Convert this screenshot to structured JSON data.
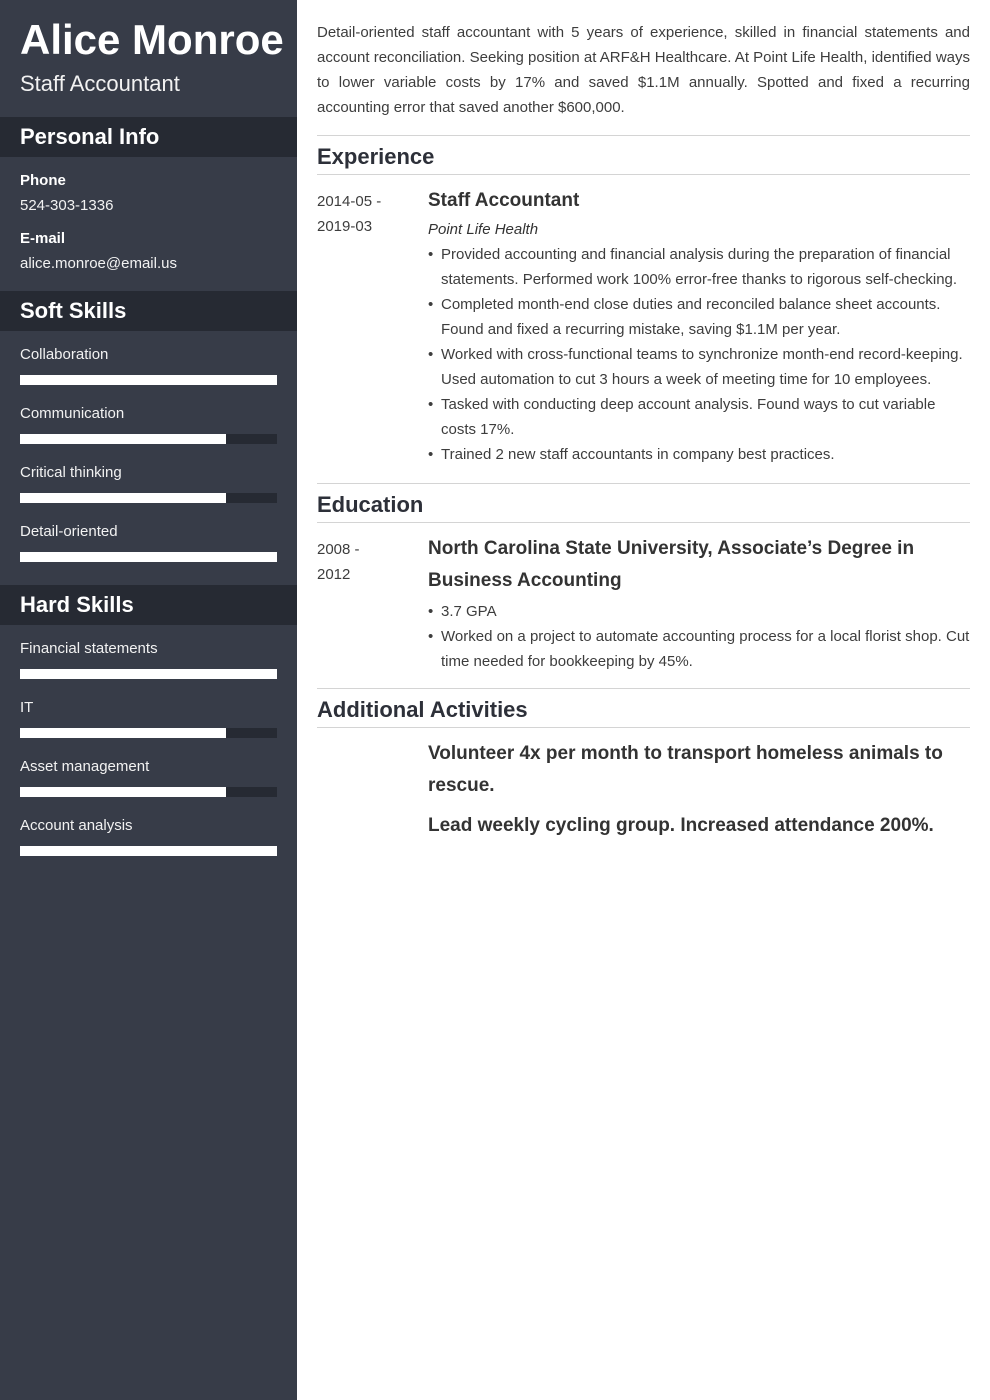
{
  "profile": {
    "name": "Alice Monroe",
    "title": "Staff Accountant"
  },
  "sidebar": {
    "personal_info": {
      "heading": "Personal Info",
      "phone_label": "Phone",
      "phone": "524-303-1336",
      "email_label": "E-mail",
      "email": "alice.monroe@email.us"
    },
    "soft_skills": {
      "heading": "Soft Skills",
      "items": [
        {
          "name": "Collaboration",
          "level": 1.0
        },
        {
          "name": "Communication",
          "level": 0.8
        },
        {
          "name": "Critical thinking",
          "level": 0.8
        },
        {
          "name": "Detail-oriented",
          "level": 1.0
        }
      ]
    },
    "hard_skills": {
      "heading": "Hard Skills",
      "items": [
        {
          "name": "Financial statements",
          "level": 1.0
        },
        {
          "name": "IT",
          "level": 0.8
        },
        {
          "name": "Asset management",
          "level": 0.8
        },
        {
          "name": "Account analysis",
          "level": 1.0
        }
      ]
    }
  },
  "summary": "Detail-oriented staff accountant with 5 years of experience, skilled in financial statements and account reconciliation. Seeking position at ARF&H Healthcare. At Point Life Health, identified ways to lower variable costs by 17% and saved $1.1M annually. Spotted and fixed a recurring accounting error that saved another $600,000.",
  "experience": {
    "heading": "Experience",
    "entries": [
      {
        "date_start": "2014-05 -",
        "date_end": "2019-03",
        "title": "Staff Accountant",
        "company": "Point Life Health",
        "bullets": [
          "Provided accounting and financial analysis during the preparation of financial statements. Performed work 100% error-free thanks to rigorous self-checking.",
          "Completed month-end close duties and reconciled balance sheet accounts. Found and fixed a recurring mistake, saving $1.1M per year.",
          "Worked with cross-functional teams to synchronize month-end record-keeping. Used automation to cut 3 hours a week of meeting time for 10 employees.",
          "Tasked with conducting deep account analysis. Found ways to cut variable costs 17%.",
          "Trained 2 new staff accountants in company best practices."
        ]
      }
    ]
  },
  "education": {
    "heading": "Education",
    "entries": [
      {
        "date_start": "2008 -",
        "date_end": "2012",
        "title": "North Carolina State University, Associate’s Degree in Business Accounting",
        "bullets": [
          "3.7 GPA",
          "Worked on a project to automate accounting process for a local florist shop. Cut time needed for bookkeeping by 45%."
        ]
      }
    ]
  },
  "activities": {
    "heading": "Additional Activities",
    "items": [
      "Volunteer 4x per month to transport homeless animals to rescue.",
      "Lead weekly cycling group. Increased attendance 200%."
    ]
  }
}
